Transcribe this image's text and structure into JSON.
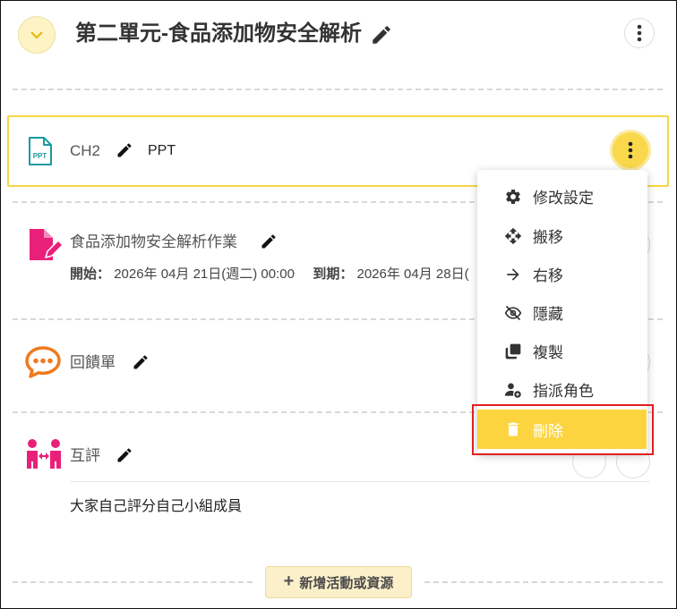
{
  "unit": {
    "title": "第二單元-食品添加物安全解析"
  },
  "activities": [
    {
      "type_icon": "ppt-file-icon",
      "icon_text": "PPT",
      "title": "CH2",
      "tag": "PPT"
    },
    {
      "type_icon": "assignment-icon",
      "title": "食品添加物安全解析作業",
      "start_label": "開始：",
      "start_value": "2026年 04月 21日(週二) 00:00",
      "due_label": "到期：",
      "due_value": "2026年 04月 28日("
    },
    {
      "type_icon": "feedback-icon",
      "title": "回饋單"
    },
    {
      "type_icon": "peer-review-icon",
      "title": "互評",
      "description": "大家自己評分自己小組成員"
    }
  ],
  "menu": {
    "items": [
      {
        "icon": "gear-icon",
        "label": "修改設定"
      },
      {
        "icon": "move-icon",
        "label": "搬移"
      },
      {
        "icon": "arrow-right-icon",
        "label": "右移"
      },
      {
        "icon": "eye-off-icon",
        "label": "隱藏"
      },
      {
        "icon": "copy-icon",
        "label": "複製"
      },
      {
        "icon": "assign-role-icon",
        "label": "指派角色"
      },
      {
        "icon": "trash-icon",
        "label": "刪除"
      }
    ]
  },
  "add_button": {
    "label": "新增活動或資源"
  },
  "colors": {
    "accent_yellow": "#f9d84b",
    "ppt_teal": "#1a9aa0",
    "assignment_pink": "#e8207a",
    "feedback_orange": "#ef7a1f",
    "highlight_red": "#e02020"
  }
}
